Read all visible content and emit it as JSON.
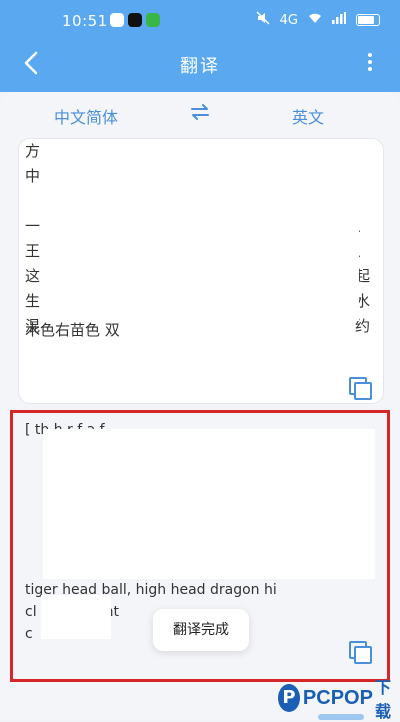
{
  "status_bar": {
    "time": "10:51",
    "right_text": "4G",
    "icons": [
      "app-icon",
      "tiktok-icon",
      "wechat-icon",
      "mute-icon",
      "wifi-icon",
      "signal-icon",
      "battery-icon"
    ]
  },
  "header": {
    "title": "翻译",
    "back_icon": "chevron-left-icon",
    "more_icon": "more-vertical-icon"
  },
  "language_bar": {
    "source": "中文简体",
    "target": "英文",
    "swap_icon": "swap-arrows-icon"
  },
  "source_panel": {
    "visible_lines": [
      "方",
      "中",
      "一",
      "王",
      "这",
      "生",
      "混"
    ],
    "right_chars": [
      "、",
      "、",
      "起",
      "水",
      "约"
    ],
    "last_line": "木色右苗色 双",
    "copy_icon": "copy-icon"
  },
  "result_panel": {
    "line_top": "[ th  h  r  f  a  f",
    "line_a": "tiger head ball, high head dragon hi",
    "line_b": "cl         g blist          cent",
    "line_c": "c",
    "toast": "翻译完成",
    "copy_icon": "copy-icon"
  },
  "watermark": {
    "logo": "P",
    "text": "PCPOP",
    "suffix": "下载"
  },
  "colors": {
    "header_blue": "#5aa8f0",
    "accent_blue": "#4a8fd9",
    "highlight_red": "#d6262a"
  }
}
